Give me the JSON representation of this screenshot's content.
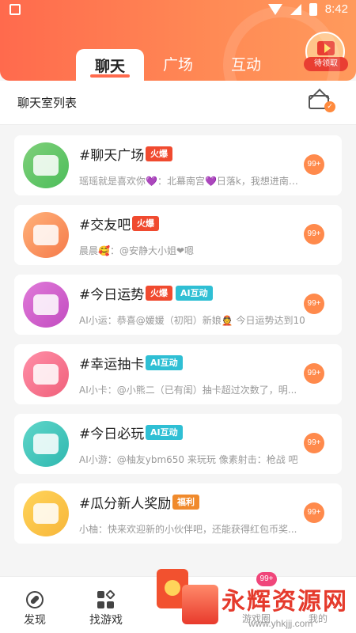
{
  "status_bar": {
    "time": "8:42"
  },
  "header": {
    "tabs": [
      {
        "label": "聊天",
        "active": true
      },
      {
        "label": "广场",
        "active": false
      },
      {
        "label": "互动",
        "active": false
      }
    ],
    "reward_label": "待领取"
  },
  "section": {
    "title": "聊天室列表"
  },
  "rooms": [
    {
      "name": "#聊天广场",
      "tags": [
        "火爆"
      ],
      "preview": "瑶瑶就是喜欢你💜：北幕南宫💜日落k，我想进南宫...",
      "unread": "99+",
      "avatar_colors": [
        "#7fd07a",
        "#4cbd5a"
      ],
      "icon": "chat-bubbles-icon"
    },
    {
      "name": "#交友吧",
      "tags": [
        "火爆"
      ],
      "preview": "晨晨🥰：@安静大小姐❤嗯",
      "unread": "99+",
      "avatar_colors": [
        "#ffb27a",
        "#f57a4a"
      ],
      "icon": "hearts-icon"
    },
    {
      "name": "#今日运势",
      "tags": [
        "火爆",
        "AI互动"
      ],
      "preview": "AI小运：恭喜@媛媛（初阳）新娘👲 今日运势达到10",
      "unread": "99+",
      "avatar_colors": [
        "#e07ad9",
        "#c24cc0"
      ],
      "icon": "fortune-slip-icon"
    },
    {
      "name": "#幸运抽卡",
      "tags": [
        "AI互动"
      ],
      "preview": "AI小卡：@小熊二（已有闺）抽卡超过次数了，明...",
      "unread": "99+",
      "avatar_colors": [
        "#ff8fa8",
        "#f0607a"
      ],
      "icon": "lucky-card-icon"
    },
    {
      "name": "#今日必玩",
      "tags": [
        "AI互动"
      ],
      "preview": "AI小游：@柚友ybm650 来玩玩 像素射击：枪战 吧",
      "unread": "99+",
      "avatar_colors": [
        "#5fd6c9",
        "#2fb8b0"
      ],
      "icon": "gamepad-icon"
    },
    {
      "name": "#瓜分新人奖励",
      "tags": [
        "福利"
      ],
      "preview": "小柚：快来欢迎新的小伙伴吧，还能获得红包币奖...",
      "unread": "99+",
      "avatar_colors": [
        "#ffd45a",
        "#f7b63a"
      ],
      "icon": "red-envelope-icon"
    }
  ],
  "tag_styles": {
    "火爆": "hot",
    "AI互动": "ai",
    "福利": "welfare"
  },
  "bottom_nav": {
    "items": [
      {
        "label": "发现",
        "icon": "compass-icon"
      },
      {
        "label": "找游戏",
        "icon": "games-icon"
      }
    ],
    "center_badge": "99+",
    "center_label": "游戏圈",
    "mine_label": "我的"
  },
  "watermark": {
    "text": "永辉资源网",
    "url": "www.yhkjjj.com"
  }
}
